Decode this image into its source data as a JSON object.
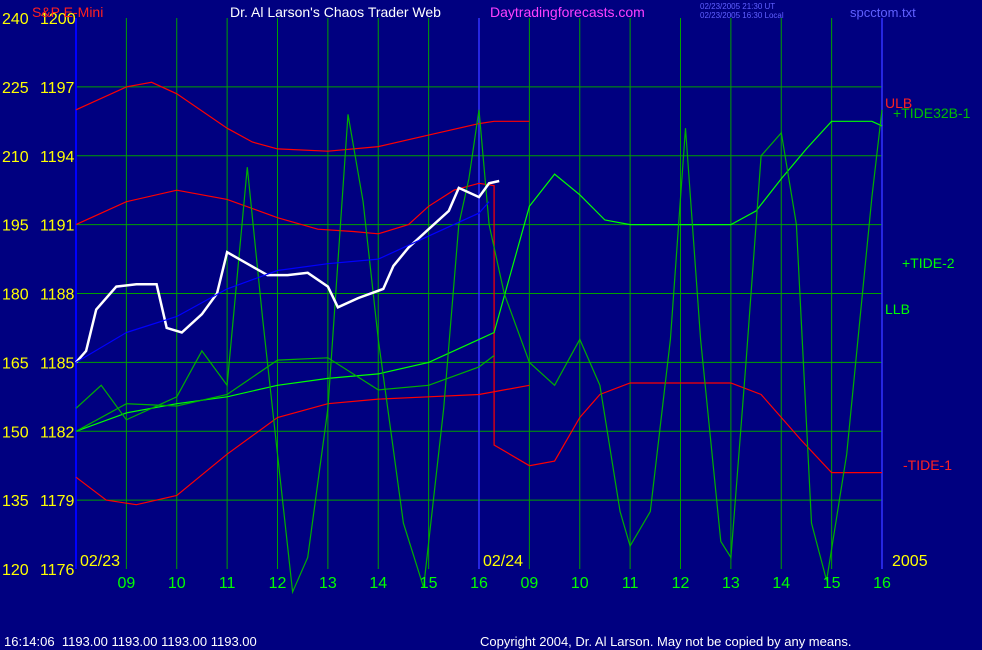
{
  "header": {
    "instrument": "S&P E-Mini",
    "title": "Dr. Al Larson's Chaos Trader Web",
    "site": "Daytradingforecasts.com",
    "ut_time": "02/23/2005 21:30 UT",
    "local_time": "02/23/2005 16:30 Local",
    "file": "spcctom.txt"
  },
  "footer": {
    "status": "16:14:06  1193.00 1193.00 1193.00 1193.00",
    "copyright": "Copyright 2004, Dr. Al Larson. May not be copied by any means."
  },
  "colors": {
    "background": "#000080",
    "grid": "#00a000",
    "y_labels": "#ffff00",
    "x_labels": "#00ff00",
    "red": "#ff0000",
    "green": "#00ff00",
    "dark_green": "#00b000",
    "yellow": "#ffff00",
    "white": "#ffffff",
    "blue": "#0000ff"
  },
  "chart_data": {
    "type": "line",
    "y_left_ticks": [
      "240",
      "225",
      "210",
      "195",
      "180",
      "165",
      "150",
      "135",
      "120"
    ],
    "y_price_ticks": [
      "1200",
      "1197",
      "1194",
      "1191",
      "1188",
      "1185",
      "1182",
      "1179",
      "1176"
    ],
    "y_price_range": [
      1176,
      1200
    ],
    "x_ticks": [
      "09",
      "10",
      "11",
      "12",
      "13",
      "14",
      "15",
      "16",
      "09",
      "10",
      "11",
      "12",
      "13",
      "14",
      "15",
      "16"
    ],
    "date_labels": [
      "02/23",
      "02/24"
    ],
    "year_label": "2005",
    "x_range_hours": [
      0,
      16
    ],
    "line_labels": {
      "ulb": "ULB",
      "llb": "LLB",
      "tide32": "+TIDE32B-1",
      "tide2": "+TIDE-2",
      "tide1": "-TIDE-1"
    },
    "series": [
      {
        "name": "ULB",
        "color": "red",
        "points": [
          [
            0,
            1196
          ],
          [
            1,
            1197
          ],
          [
            1.5,
            1197.2
          ],
          [
            2,
            1196.7
          ],
          [
            3,
            1195.2
          ],
          [
            3.5,
            1194.6
          ],
          [
            4,
            1194.3
          ],
          [
            5,
            1194.2
          ],
          [
            6,
            1194.4
          ],
          [
            7,
            1194.9
          ],
          [
            8,
            1195.4
          ],
          [
            8.3,
            1195.5
          ],
          [
            9,
            1195.5
          ]
        ]
      },
      {
        "name": "LLB",
        "color": "red",
        "points": [
          [
            0,
            1180
          ],
          [
            0.6,
            1179
          ],
          [
            1.2,
            1178.8
          ],
          [
            2,
            1179.2
          ],
          [
            3,
            1181
          ],
          [
            4,
            1182.6
          ],
          [
            5,
            1183.2
          ],
          [
            6,
            1183.4
          ],
          [
            7,
            1183.5
          ],
          [
            8,
            1183.6
          ],
          [
            9,
            1184
          ]
        ]
      },
      {
        "name": "Mid band",
        "color": "red",
        "points": [
          [
            0,
            1191
          ],
          [
            1,
            1192
          ],
          [
            2,
            1192.5
          ],
          [
            3,
            1192.1
          ],
          [
            4,
            1191.3
          ],
          [
            4.8,
            1190.8
          ],
          [
            5.5,
            1190.7
          ],
          [
            6,
            1190.6
          ],
          [
            6.6,
            1191
          ],
          [
            7,
            1191.8
          ],
          [
            7.5,
            1192.5
          ],
          [
            8,
            1192.8
          ],
          [
            8.3,
            1192.7
          ],
          [
            8.3,
            1181.4
          ],
          [
            9,
            1180.5
          ],
          [
            9.5,
            1180.7
          ],
          [
            10,
            1182.6
          ],
          [
            10.4,
            1183.6
          ],
          [
            11,
            1184.1
          ],
          [
            12,
            1184.1
          ],
          [
            13,
            1184.1
          ],
          [
            13.6,
            1183.6
          ],
          [
            14.4,
            1181.6
          ],
          [
            15,
            1180.2
          ],
          [
            15.8,
            1180.2
          ],
          [
            16,
            1180.2
          ]
        ]
      },
      {
        "name": "+TIDE32B-1",
        "color": "green",
        "points": [
          [
            0,
            1182
          ],
          [
            1,
            1182.8
          ],
          [
            2,
            1183.2
          ],
          [
            3,
            1183.5
          ],
          [
            4,
            1184
          ],
          [
            5,
            1184.3
          ],
          [
            6,
            1184.5
          ],
          [
            7,
            1185
          ],
          [
            8,
            1186
          ],
          [
            8.3,
            1186.3
          ],
          [
            9,
            1191.8
          ],
          [
            9.5,
            1193.2
          ],
          [
            10,
            1192.3
          ],
          [
            10.5,
            1191.2
          ],
          [
            11,
            1191
          ],
          [
            12,
            1191
          ],
          [
            13,
            1191
          ],
          [
            13.5,
            1191.6
          ],
          [
            14,
            1193
          ],
          [
            14.5,
            1194.3
          ],
          [
            15,
            1195.5
          ],
          [
            15.8,
            1195.5
          ],
          [
            16,
            1195.3
          ]
        ]
      },
      {
        "name": "+TIDE-2",
        "color": "dark_green",
        "points": [
          [
            0,
            1182
          ],
          [
            1,
            1183.2
          ],
          [
            2,
            1183.1
          ],
          [
            3,
            1183.6
          ],
          [
            4,
            1185.1
          ],
          [
            5,
            1185.2
          ],
          [
            6,
            1183.8
          ],
          [
            7,
            1184
          ],
          [
            8,
            1184.8
          ],
          [
            8.3,
            1185.3
          ]
        ]
      },
      {
        "name": "Oscillator",
        "color": "dark_green",
        "points": [
          [
            0,
            1183
          ],
          [
            0.5,
            1184
          ],
          [
            1,
            1182.5
          ],
          [
            1.5,
            1183
          ],
          [
            2,
            1183.5
          ],
          [
            2.5,
            1185.5
          ],
          [
            3,
            1184
          ],
          [
            3.4,
            1193.5
          ],
          [
            3.7,
            1187
          ],
          [
            4,
            1181
          ],
          [
            4.3,
            1175
          ],
          [
            4.6,
            1176.5
          ],
          [
            5,
            1183
          ],
          [
            5.4,
            1195.8
          ],
          [
            5.7,
            1192
          ],
          [
            6,
            1186
          ],
          [
            6.5,
            1178
          ],
          [
            6.9,
            1175.2
          ],
          [
            7.3,
            1183
          ],
          [
            7.6,
            1191
          ],
          [
            7.8,
            1193
          ],
          [
            8,
            1196
          ],
          [
            8.2,
            1191
          ],
          [
            8.5,
            1188
          ],
          [
            9,
            1185
          ],
          [
            9.5,
            1184
          ],
          [
            10,
            1186
          ],
          [
            10.4,
            1184
          ],
          [
            10.8,
            1178.5
          ],
          [
            11,
            1177
          ],
          [
            11.4,
            1178.5
          ],
          [
            11.8,
            1186
          ],
          [
            12.1,
            1195.2
          ],
          [
            12.4,
            1186
          ],
          [
            12.8,
            1177.2
          ],
          [
            13,
            1176.5
          ],
          [
            13.3,
            1185
          ],
          [
            13.6,
            1194
          ],
          [
            14,
            1195
          ],
          [
            14.3,
            1191
          ],
          [
            14.6,
            1178
          ],
          [
            14.9,
            1175.5
          ],
          [
            15.3,
            1181
          ],
          [
            15.8,
            1192.2
          ],
          [
            16,
            1196
          ]
        ]
      },
      {
        "name": "Price",
        "color": "white",
        "points": [
          [
            0,
            1185
          ],
          [
            0.2,
            1185.5
          ],
          [
            0.4,
            1187.3
          ],
          [
            0.8,
            1188.3
          ],
          [
            1.2,
            1188.4
          ],
          [
            1.6,
            1188.4
          ],
          [
            1.8,
            1186.5
          ],
          [
            2.1,
            1186.3
          ],
          [
            2.5,
            1187.1
          ],
          [
            2.8,
            1188
          ],
          [
            3,
            1189.8
          ],
          [
            3.4,
            1189.3
          ],
          [
            3.8,
            1188.8
          ],
          [
            4.2,
            1188.8
          ],
          [
            4.6,
            1188.9
          ],
          [
            5,
            1188.3
          ],
          [
            5.2,
            1187.4
          ],
          [
            5.6,
            1187.8
          ],
          [
            6.1,
            1188.2
          ],
          [
            6.3,
            1189.2
          ],
          [
            6.6,
            1190
          ],
          [
            7,
            1190.8
          ],
          [
            7.4,
            1191.6
          ],
          [
            7.6,
            1192.6
          ],
          [
            8,
            1192.2
          ],
          [
            8.2,
            1192.8
          ],
          [
            8.4,
            1192.9
          ]
        ]
      },
      {
        "name": "Blue trend",
        "color": "blue",
        "points": [
          [
            0,
            1185
          ],
          [
            1,
            1186.3
          ],
          [
            2,
            1187
          ],
          [
            3,
            1188.2
          ],
          [
            4,
            1189
          ],
          [
            5,
            1189.3
          ],
          [
            6,
            1189.5
          ],
          [
            7,
            1190.5
          ],
          [
            8,
            1191.5
          ],
          [
            8.2,
            1192
          ]
        ]
      }
    ]
  }
}
